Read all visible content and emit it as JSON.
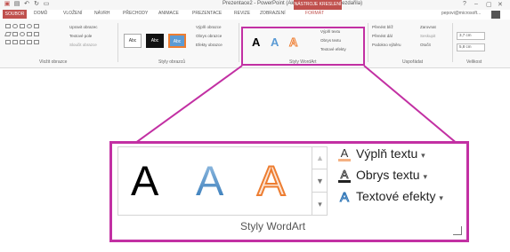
{
  "window": {
    "title": "Prezentace2 - PowerPoint (Aktivace produktu se nezdařila)",
    "context_tab_group": "NÁSTROJE KRESLENÍ",
    "controls": [
      "?",
      "–",
      "▢",
      "✕"
    ]
  },
  "tabs": [
    {
      "label": "SOUBOR"
    },
    {
      "label": "DOMŮ"
    },
    {
      "label": "VLOŽENÍ"
    },
    {
      "label": "NÁVRH"
    },
    {
      "label": "PŘECHODY"
    },
    {
      "label": "ANIMACE"
    },
    {
      "label": "PREZENTACE"
    },
    {
      "label": "REVIZE"
    },
    {
      "label": "ZOBRAZENÍ"
    },
    {
      "label": "FORMÁT"
    }
  ],
  "account": "pepovi@microsoft...",
  "ribbon": {
    "insert_shapes": {
      "label": "Vložit obrazce",
      "edit_shape": "Upravit obrazec",
      "text_box": "Textové pole",
      "merge_shapes": "Sloučit obrazce"
    },
    "shape_styles": {
      "label": "Styly obrazců",
      "samples": [
        "Abc",
        "Abc",
        "Abc"
      ],
      "fill": "Výplň obrazce",
      "outline": "Obrys obrazce",
      "effects": "Efekty obrazce"
    },
    "wordart_small": {
      "label": "Styly WordArt",
      "letters": [
        "A",
        "A",
        "A"
      ],
      "fill": "Výplň textu",
      "outline": "Obrys textu",
      "effects": "Textové efekty"
    },
    "arrange": {
      "label": "Uspořádat",
      "bring_forward": "Přenést blíž",
      "send_backward": "Přenést dál",
      "selection_pane": "Podokno výběru",
      "align": "Zarovnat",
      "group": "Seskupit",
      "rotate": "Otočit"
    },
    "size": {
      "label": "Velikost",
      "height": "3,7 cm",
      "width": "5,8 cm"
    }
  },
  "zoom": {
    "group_title": "Styly WordArt",
    "gallery_letters": [
      {
        "letter": "A",
        "style": "black"
      },
      {
        "letter": "A",
        "style": "blue-gradient"
      },
      {
        "letter": "A",
        "style": "orange-outline"
      }
    ],
    "scroll_buttons": [
      "▲",
      "▼",
      "▾"
    ],
    "commands": [
      {
        "label": "Výplň textu",
        "icon": "text-fill-icon"
      },
      {
        "label": "Obrys textu",
        "icon": "text-outline-icon"
      },
      {
        "label": "Textové efekty",
        "icon": "text-effects-icon"
      }
    ],
    "caret": "▾"
  },
  "colors": {
    "file_tab": "#c0504d",
    "highlight": "#c230a3",
    "wordart_blue": "#5b9bd5",
    "wordart_orange": "#ed7d31"
  }
}
